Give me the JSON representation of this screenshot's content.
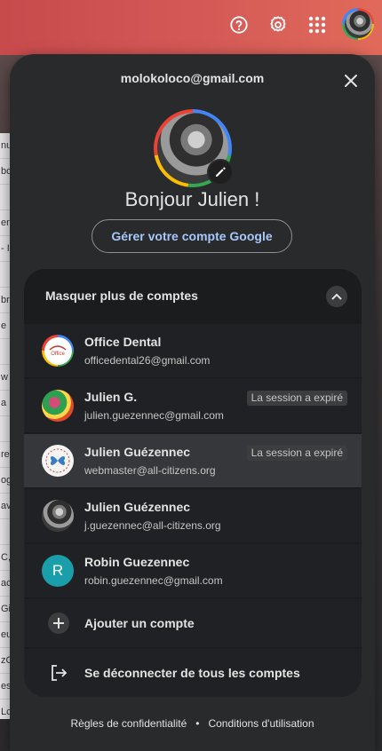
{
  "topbar": {
    "help_icon": "help-circle-icon",
    "settings_icon": "gear-icon",
    "apps_icon": "apps-grid-icon"
  },
  "popup": {
    "email": "molokoloco@gmail.com",
    "greeting": "Bonjour Julien !",
    "manage_label": "Gérer votre compte Google",
    "accounts_toggle_label": "Masquer plus de comptes",
    "accounts": [
      {
        "name": "Office Dental",
        "email": "officedental26@gmail.com",
        "badge": ""
      },
      {
        "name": "Julien G.",
        "email": "julien.guezennec@gmail.com",
        "badge": "La session a expiré"
      },
      {
        "name": "Julien Guézennec",
        "email": "webmaster@all-citizens.org",
        "badge": "La session a expiré"
      },
      {
        "name": "Julien Guézennec",
        "email": "j.guezennec@all-citizens.org",
        "badge": ""
      },
      {
        "name": "Robin Guezennec",
        "email": "robin.guezennec@gmail.com",
        "badge": "",
        "initial": "R"
      }
    ],
    "add_account_label": "Ajouter un compte",
    "signout_label": "Se déconnecter de tous les comptes",
    "privacy_label": "Règles de confidentialité",
    "separator": "•",
    "terms_label": "Conditions d'utilisation",
    "office_logo_text": "Office"
  },
  "colors": {
    "accent_link": "#a8c7fa",
    "robin_avatar": "#1a9faa"
  },
  "background": {
    "strip": [
      "nu",
      "bo",
      "",
      "er",
      "- I",
      "",
      "br",
      "e",
      "",
      "w",
      "a",
      "",
      "re",
      "og",
      "av",
      "",
      "C,",
      "ac",
      "Gi",
      "eu",
      "zG",
      "es",
      "Lc"
    ]
  }
}
